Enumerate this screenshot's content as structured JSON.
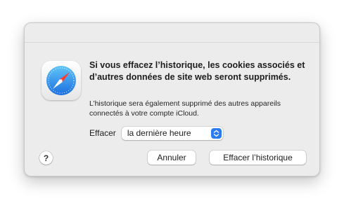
{
  "dialog": {
    "app_icon": "safari-compass-icon",
    "title": "Si vous effacez l’historique, les cookies associés et d’autres données de site web seront supprimés.",
    "info": "L’historique sera également supprimé des autres appareils connectés à votre compte iCloud.",
    "range_label": "Effacer",
    "range_value": "la dernière heure",
    "help_label": "?",
    "cancel_label": "Annuler",
    "clear_label": "Effacer l’historique"
  },
  "colors": {
    "accent": "#2a7cf5",
    "sheet_background": "#ececec"
  }
}
